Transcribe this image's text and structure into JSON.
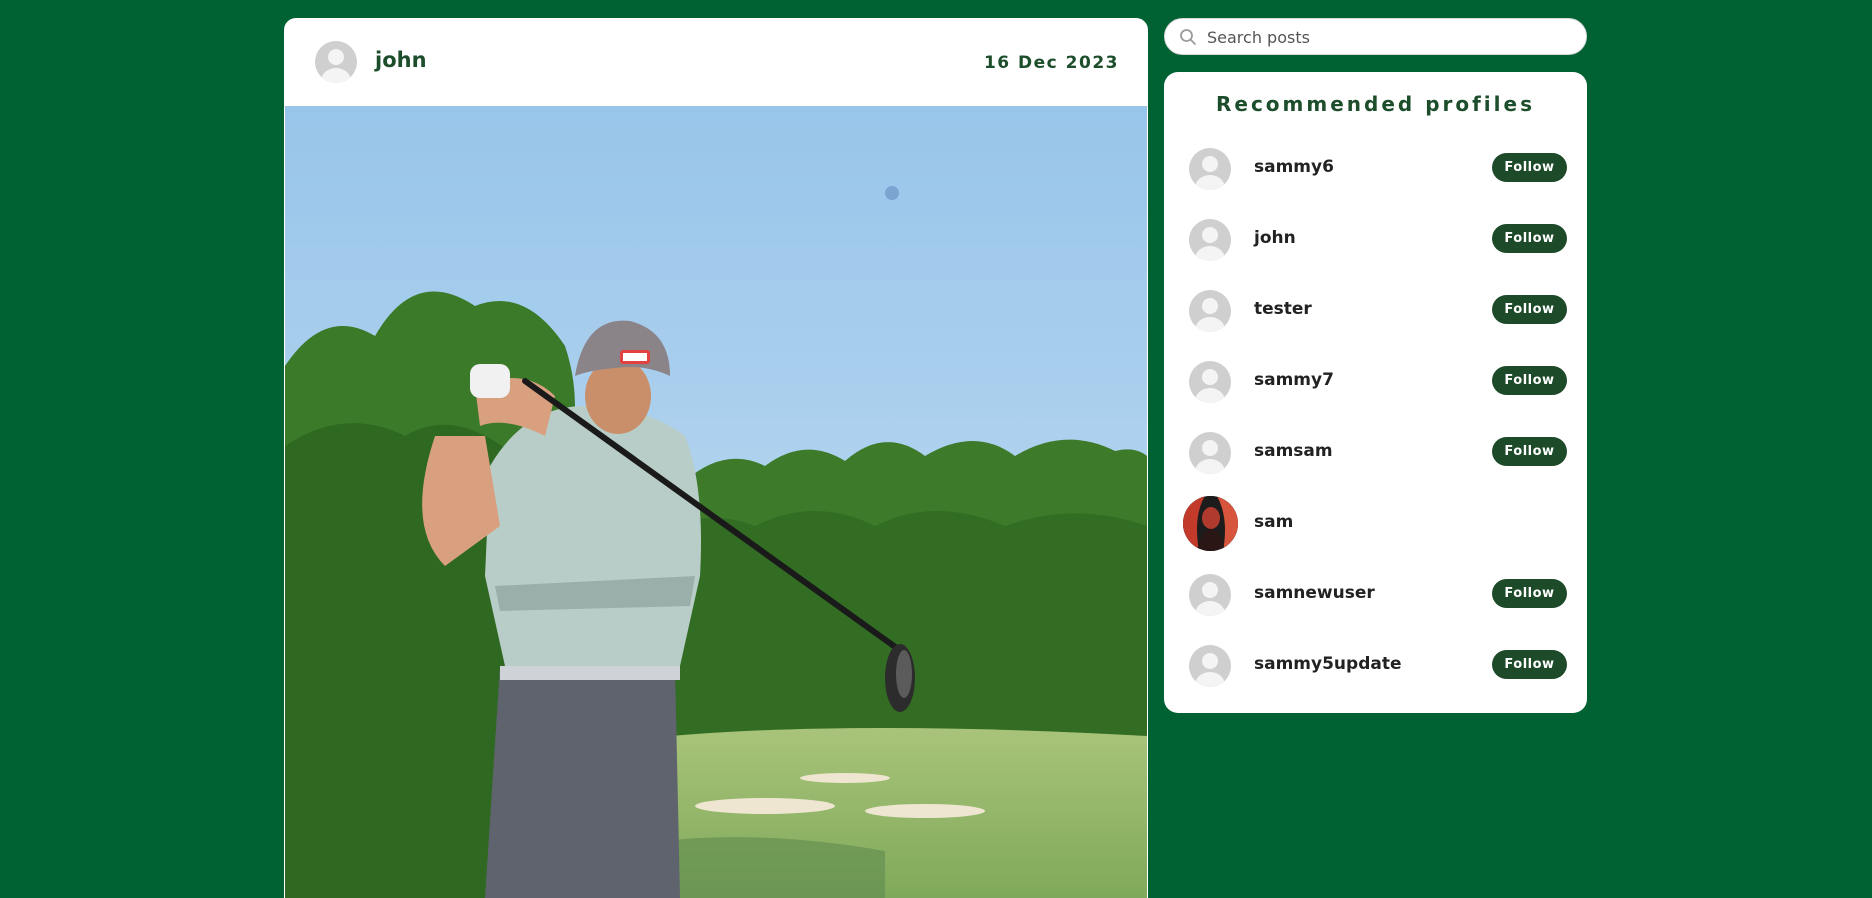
{
  "post": {
    "author": "john",
    "date": "16 Dec 2023",
    "image_alt": "Golfer swinging a driver on a golf course"
  },
  "search": {
    "placeholder": "Search posts"
  },
  "recommended": {
    "title": "Recommended profiles",
    "follow_label": "Follow",
    "profiles": [
      {
        "name": "sammy6",
        "show_follow": true
      },
      {
        "name": "john",
        "show_follow": true
      },
      {
        "name": "tester",
        "show_follow": true
      },
      {
        "name": "sammy7",
        "show_follow": true
      },
      {
        "name": "samsam",
        "show_follow": true
      },
      {
        "name": "sam",
        "show_follow": false
      },
      {
        "name": "samnewuser",
        "show_follow": true
      },
      {
        "name": "sammy5update",
        "show_follow": true
      }
    ]
  },
  "colors": {
    "background": "#006233",
    "accent": "#1d4a29",
    "text_green": "#1d4e2b"
  },
  "icons": [
    "avatar-placeholder-icon",
    "search-icon"
  ]
}
